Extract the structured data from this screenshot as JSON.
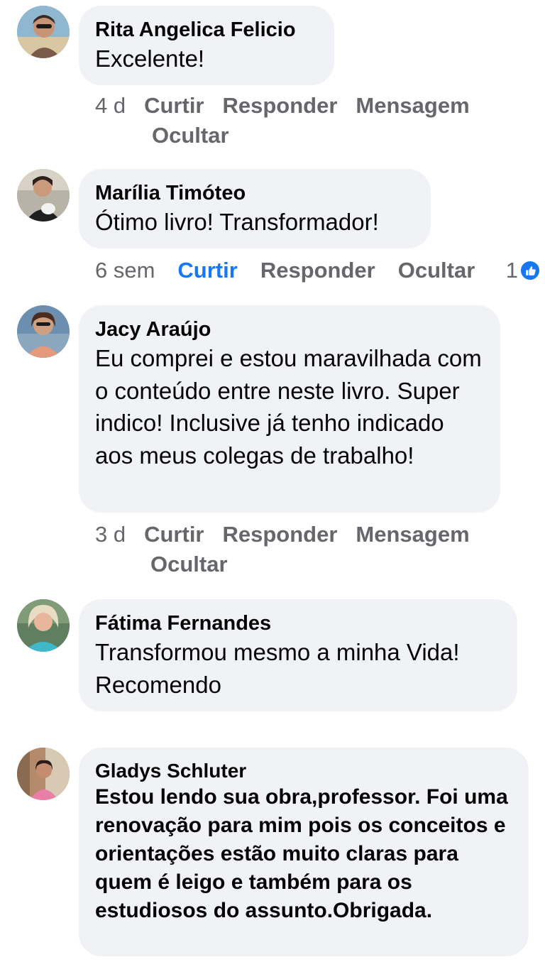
{
  "comments": [
    {
      "author": "Rita Angelica Felicio",
      "text": "Excelente!",
      "age": "4 d",
      "actions": [
        "Curtir",
        "Responder",
        "Mensagem",
        "Ocultar"
      ]
    },
    {
      "author": "Marília Timóteo",
      "text": "Ótimo livro! Transformador!",
      "age": "6 sem",
      "actions": [
        "Curtir",
        "Responder",
        "Ocultar"
      ],
      "liked": true,
      "reaction_count": "1",
      "reaction_icon": "thumbs-up-icon"
    },
    {
      "author": "Jacy Araújo",
      "text": "Eu comprei e estou maravilhada com o conteúdo entre neste livro. Super indico!  Inclusive já tenho indicado aos meus colegas de trabalho!",
      "age": "3 d",
      "actions": [
        "Curtir",
        "Responder",
        "Mensagem",
        "Ocultar"
      ]
    },
    {
      "author": "Fátima Fernandes",
      "text": "Transformou mesmo a minha Vida! Recomendo"
    },
    {
      "author": "Gladys Schluter",
      "text": "Estou lendo sua obra,professor. Foi uma renovação para mim pois os conceitos e orientações estão muito claras para quem é leigo e também para os estudiosos do assunto.Obrigada."
    }
  ],
  "colors": {
    "bubble": "#f0f2f5",
    "secondary_text": "#65676b",
    "accent_blue": "#1877f2"
  }
}
